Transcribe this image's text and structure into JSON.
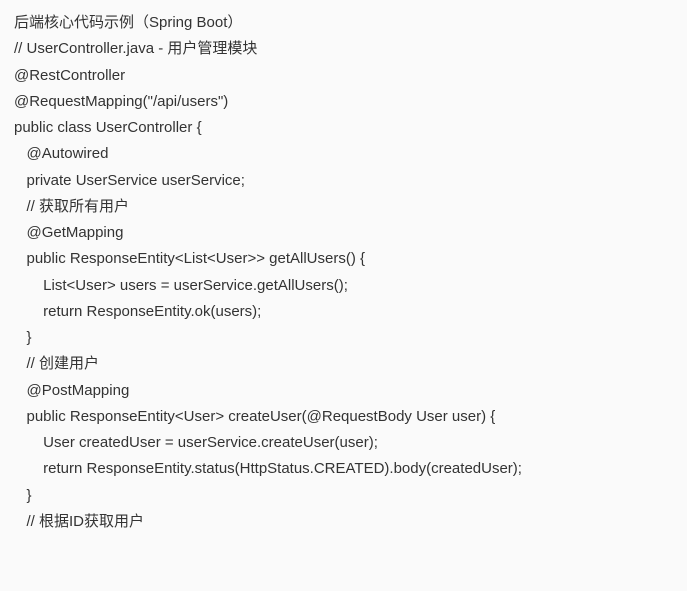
{
  "code": {
    "lines": [
      "后端核心代码示例（Spring Boot）",
      "// UserController.java - 用户管理模块",
      "@RestController",
      "@RequestMapping(\"/api/users\")",
      "public class UserController {",
      "",
      "   @Autowired",
      "   private UserService userService;",
      "",
      "   // 获取所有用户",
      "   @GetMapping",
      "   public ResponseEntity<List<User>> getAllUsers() {",
      "       List<User> users = userService.getAllUsers();",
      "       return ResponseEntity.ok(users);",
      "   }",
      "",
      "   // 创建用户",
      "   @PostMapping",
      "   public ResponseEntity<User> createUser(@RequestBody User user) {",
      "       User createdUser = userService.createUser(user);",
      "       return ResponseEntity.status(HttpStatus.CREATED).body(createdUser);",
      "   }",
      "",
      "   // 根据ID获取用户"
    ]
  }
}
